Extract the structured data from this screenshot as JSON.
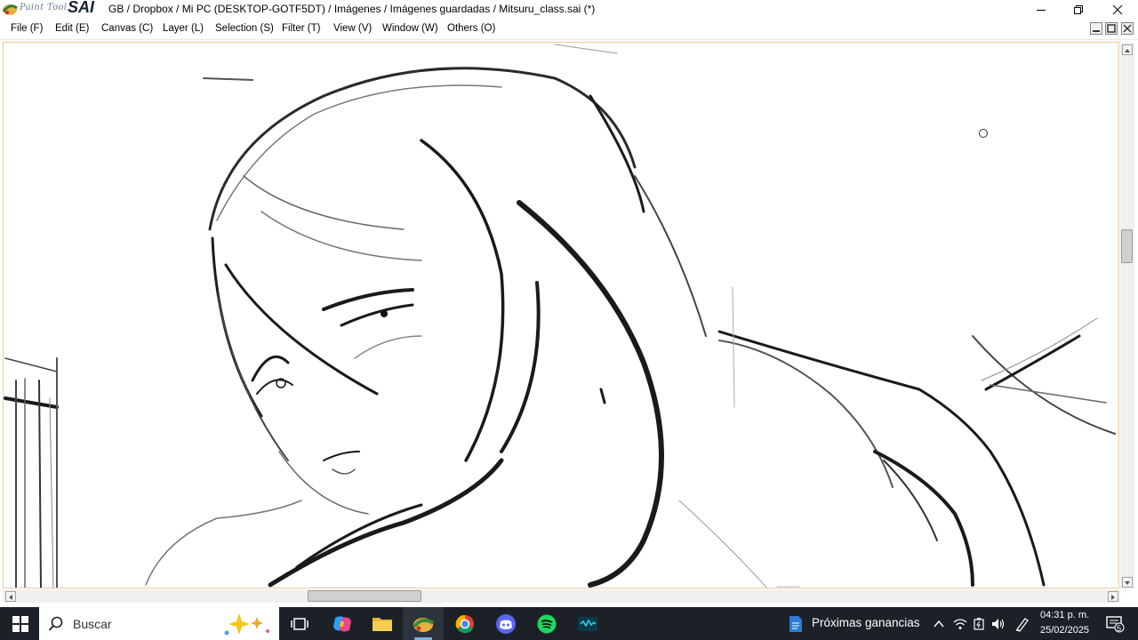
{
  "app": {
    "logo_small": "Paint Tool",
    "logo_big": "SAI",
    "window_title": "GB / Dropbox / Mi PC (DESKTOP-GOTF5DT) / Imágenes / Imágenes guardadas / Mitsuru_class.sai (*)"
  },
  "menu": {
    "items": [
      {
        "label": "File (F)"
      },
      {
        "label": "Edit (E)"
      },
      {
        "label": "Canvas (C)"
      },
      {
        "label": "Layer (L)"
      },
      {
        "label": "Selection (S)"
      },
      {
        "label": "Filter (T)"
      },
      {
        "label": "View (V)"
      },
      {
        "label": "Window (W)"
      },
      {
        "label": "Others (O)"
      }
    ]
  },
  "canvas": {
    "content": "rough line sketch of anime character (Mitsuru)"
  },
  "scroll": {
    "vertical_position": 0.35,
    "horizontal_position": 0.28
  },
  "taskbar": {
    "search_placeholder": "Buscar",
    "widget_text": "Próximas ganancias",
    "time": "04:31 p. m.",
    "date": "25/02/2025",
    "notification_count": "5",
    "apps": [
      "task-view-icon",
      "copilot-icon",
      "file-explorer-icon",
      "painttool-sai-icon",
      "chrome-icon",
      "discord-icon",
      "spotify-icon",
      "audio-app-icon"
    ]
  },
  "colors": {
    "taskbar_bg": "#1c2128",
    "canvas_border": "#f0c898",
    "accent": "#7fb2e5"
  }
}
